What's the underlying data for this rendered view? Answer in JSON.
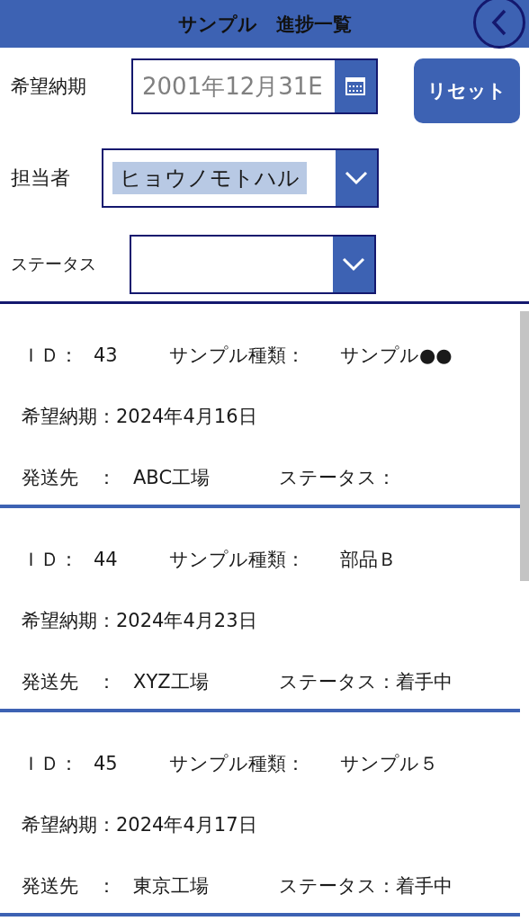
{
  "header": {
    "title": "サンプル　進捗一覧"
  },
  "filters": {
    "due_date": {
      "label": "希望納期",
      "value": "2001年12月31E"
    },
    "reset_button": "リセット",
    "assignee": {
      "label": "担当者",
      "value": "ヒョウノモトハル",
      "highlighted": true
    },
    "status": {
      "label": "ステータス"
    }
  },
  "rows": [
    {
      "id_label": "ＩＤ：",
      "id": "43",
      "type_label": "サンプル種類：",
      "type": "サンプル●●",
      "due_label": "希望納期：",
      "due": "2024年4月16日",
      "destination_label": "発送先　：",
      "destination": "ABC工場",
      "status_label": "ステータス："
    },
    {
      "id_label": "ＩＤ：",
      "id": "44",
      "type_label": "サンプル種類：",
      "type": "部品Ｂ",
      "due_label": "希望納期：",
      "due": "2024年4月23日",
      "destination_label": "発送先　：",
      "destination": "XYZ工場",
      "status_label": "ステータス：",
      "status": "着手中"
    },
    {
      "id_label": "ＩＤ：",
      "id": "45",
      "type_label": "サンプル種類：",
      "type": "サンプル５",
      "due_label": "希望納期：",
      "due": "2024年4月17日",
      "destination_label": "発送先　：",
      "destination": "東京工場",
      "status_label": "ステータス：",
      "status": "着手中"
    }
  ]
}
